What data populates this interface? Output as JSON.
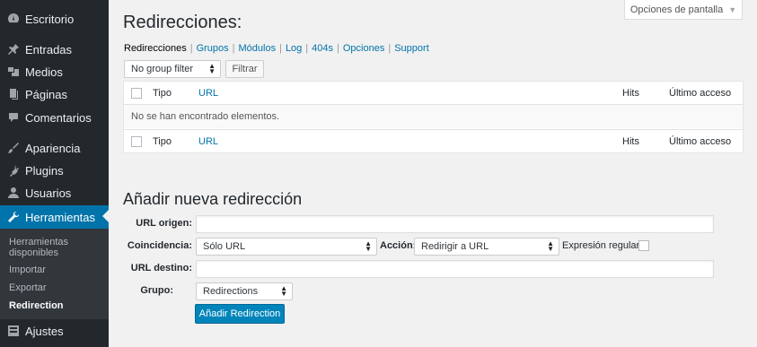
{
  "sidebar": {
    "items": [
      {
        "label": "Escritorio",
        "icon": "dashboard-icon"
      },
      {
        "label": "Entradas",
        "icon": "pin-icon"
      },
      {
        "label": "Medios",
        "icon": "media-icon"
      },
      {
        "label": "Páginas",
        "icon": "pages-icon"
      },
      {
        "label": "Comentarios",
        "icon": "comment-icon"
      },
      {
        "label": "Apariencia",
        "icon": "brush-icon"
      },
      {
        "label": "Plugins",
        "icon": "plugin-icon"
      },
      {
        "label": "Usuarios",
        "icon": "user-icon"
      },
      {
        "label": "Herramientas",
        "icon": "wrench-icon"
      },
      {
        "label": "Ajustes",
        "icon": "settings-icon"
      }
    ],
    "submenu": [
      "Herramientas disponibles",
      "Importar",
      "Exportar",
      "Redirection"
    ],
    "accent": "#0073aa",
    "background": "#23282d"
  },
  "header": {
    "screen_options": "Opciones de pantalla",
    "title": "Redirecciones:"
  },
  "subnav": [
    "Redirecciones",
    "Grupos",
    "Módulos",
    "Log",
    "404s",
    "Opciones",
    "Support"
  ],
  "filter": {
    "group_select": "No group filter",
    "button": "Filtrar"
  },
  "table": {
    "columns": [
      "Tipo",
      "URL",
      "Hits",
      "Último acceso"
    ],
    "empty_message": "No se han encontrado elementos."
  },
  "add_form": {
    "title": "Añadir nueva redirección",
    "url_origen_label": "URL origen:",
    "url_origen_value": "",
    "coincidencia_label": "Coincidencia:",
    "coincidencia_value": "Sólo URL",
    "accion_label": "Acción:",
    "accion_value": "Redirigir a URL",
    "regex_label": "Expresión regular:",
    "url_destino_label": "URL destino:",
    "url_destino_value": "",
    "grupo_label": "Grupo:",
    "grupo_value": "Redirections",
    "submit": "Añadir Redirection"
  }
}
